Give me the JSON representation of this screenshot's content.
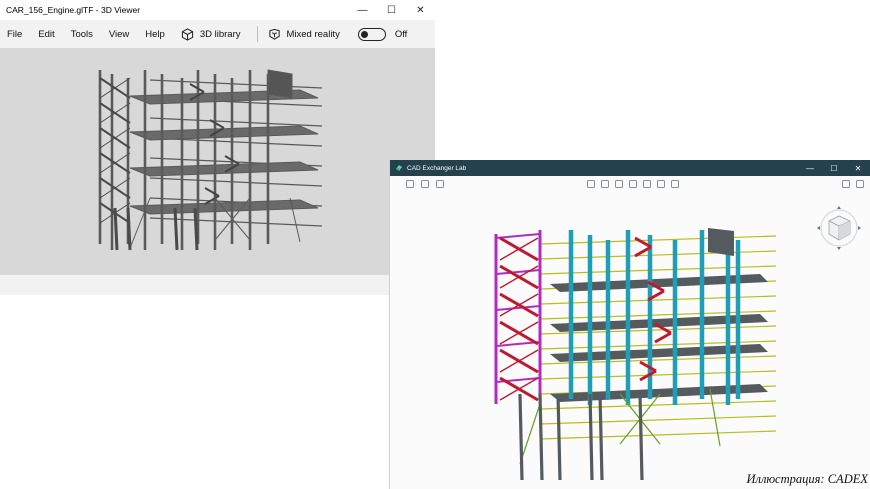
{
  "viewer": {
    "title": "CAR_156_Engine.glTF - 3D Viewer",
    "controls": {
      "minimize": "—",
      "maximize": "☐",
      "close": "✕"
    },
    "menu": [
      "File",
      "Edit",
      "Tools",
      "View",
      "Help"
    ],
    "library_label": "3D library",
    "mixed_reality_label": "Mixed reality",
    "toggle_state": "Off",
    "background": "#d8d8d9",
    "model_color": "#5a5a5a"
  },
  "cad": {
    "title": "CAD Exchanger Lab",
    "controls": {
      "minimize": "—",
      "maximize": "☐",
      "close": "✕"
    },
    "titlebar_color": "#24414d",
    "colors": {
      "stairs": "#c0182e",
      "frame": "#b02bc0",
      "columns": "#1f9fb5",
      "beams": "#b8be1e",
      "braces": "#6aa023",
      "decks": "#555a5e"
    }
  },
  "credit": "Иллюстрация: CADEX"
}
